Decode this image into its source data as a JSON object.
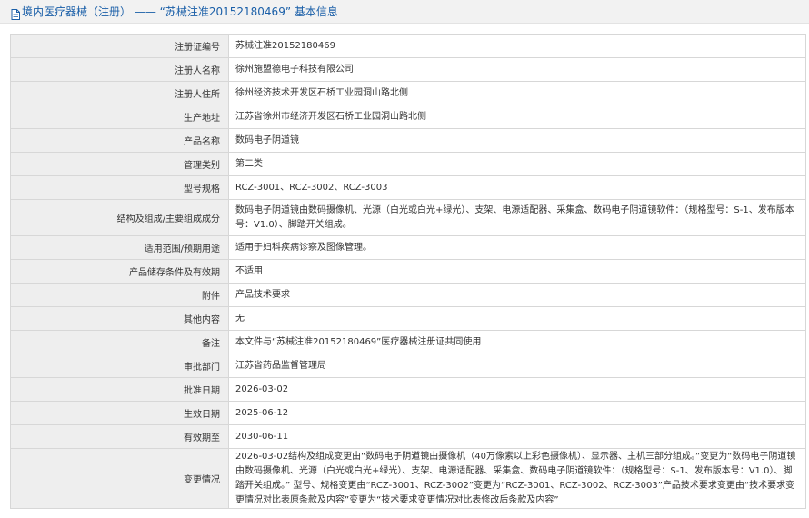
{
  "page_title": "境内医疗器械（注册） —— “苏械注准20152180469” 基本信息",
  "rows": [
    {
      "label": "注册证编号",
      "value": "苏械注准20152180469"
    },
    {
      "label": "注册人名称",
      "value": "徐州施盟德电子科技有限公司"
    },
    {
      "label": "注册人住所",
      "value": "徐州经济技术开发区石桥工业园洞山路北侧"
    },
    {
      "label": "生产地址",
      "value": "江苏省徐州市经济开发区石桥工业园洞山路北侧"
    },
    {
      "label": "产品名称",
      "value": "数码电子阴道镜"
    },
    {
      "label": "管理类别",
      "value": "第二类"
    },
    {
      "label": "型号规格",
      "value": "RCZ-3001、RCZ-3002、RCZ-3003"
    },
    {
      "label": "结构及组成/主要组成成分",
      "value": "数码电子阴道镜由数码摄像机、光源（白光或白光+绿光）、支架、电源适配器、采集盒、数码电子阴道镜软件：（规格型号：S-1、发布版本号：V1.0）、脚踏开关组成。"
    },
    {
      "label": "适用范围/预期用途",
      "value": "适用于妇科疾病诊察及图像管理。"
    },
    {
      "label": "产品储存条件及有效期",
      "value": "不适用"
    },
    {
      "label": "附件",
      "value": "产品技术要求"
    },
    {
      "label": "其他内容",
      "value": "无"
    },
    {
      "label": "备注",
      "value": "本文件与“苏械注准20152180469”医疗器械注册证共同使用"
    },
    {
      "label": "审批部门",
      "value": "江苏省药品监督管理局"
    },
    {
      "label": "批准日期",
      "value": "2026-03-02"
    },
    {
      "label": "生效日期",
      "value": "2025-06-12"
    },
    {
      "label": "有效期至",
      "value": "2030-06-11"
    },
    {
      "label": "变更情况",
      "value": "2026-03-02结构及组成变更由“数码电子阴道镜由摄像机（40万像素以上彩色摄像机）、显示器、主机三部分组成。”变更为“数码电子阴道镜由数码摄像机、光源（白光或白光+绿光）、支架、电源适配器、采集盒、数码电子阴道镜软件：（规格型号：S-1、发布版本号：V1.0）、脚踏开关组成。” 型号、规格变更由“RCZ-3001、RCZ-3002”变更为“RCZ-3001、RCZ-3002、RCZ-3003”产品技术要求变更由“技术要求变更情况对比表原条款及内容”变更为“技术要求变更情况对比表修改后条款及内容”"
    }
  ]
}
